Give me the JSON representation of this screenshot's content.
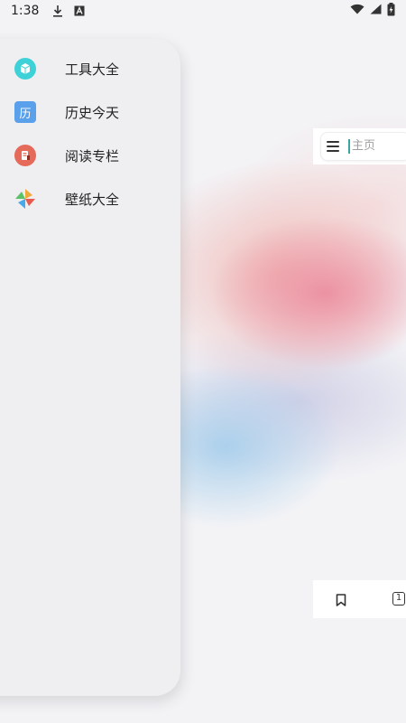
{
  "status_bar": {
    "time": "1:38",
    "left_icons": [
      "download-icon",
      "a-icon"
    ],
    "right_icons": [
      "wifi-icon",
      "signal-icon",
      "battery-icon"
    ]
  },
  "drawer": {
    "items": [
      {
        "label": "工具大全",
        "icon": "cube-icon",
        "color": "#3ed1d8"
      },
      {
        "label": "历史今天",
        "icon": "history-icon",
        "icon_text": "历",
        "color": "#5aa0ea"
      },
      {
        "label": "阅读专栏",
        "icon": "reading-icon",
        "color": "#e56a59"
      },
      {
        "label": "壁纸大全",
        "icon": "pinwheel-icon",
        "color": "#f2a93b"
      }
    ]
  },
  "search": {
    "placeholder_text": "主页"
  },
  "bottom_bar": {
    "tab_count": "1"
  }
}
